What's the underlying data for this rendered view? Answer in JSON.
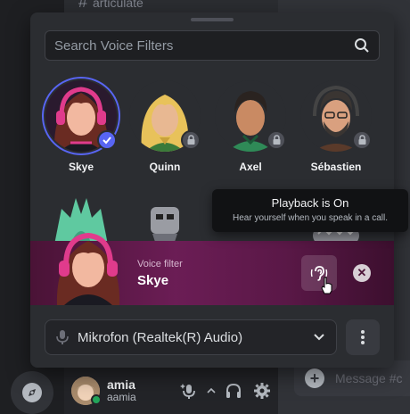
{
  "background": {
    "channel_name": "articulate",
    "message_placeholder": "Message #c"
  },
  "user_panel": {
    "username": "amia",
    "tag": "aamia"
  },
  "popup": {
    "search": {
      "placeholder": "Search Voice Filters"
    },
    "filters": [
      {
        "name": "Skye",
        "state": "selected",
        "hair": "#6a2b22",
        "skin": "#f2b8a0",
        "accent": "#e03b8c"
      },
      {
        "name": "Quinn",
        "state": "locked",
        "hair": "#e8c25a",
        "skin": "#e8b892",
        "accent": "#3a7a3a"
      },
      {
        "name": "Axel",
        "state": "locked",
        "hair": "#2a2320",
        "skin": "#c98a63",
        "accent": "#2f8a57"
      },
      {
        "name": "Sébastien",
        "state": "locked",
        "hair": "#3a3532",
        "skin": "#d9a07f",
        "accent": "#5a3a2a"
      }
    ],
    "banner": {
      "label": "Voice filter",
      "value": "Skye"
    },
    "microphone": {
      "selected": "Mikrofon (Realtek(R) Audio)"
    }
  },
  "tooltip": {
    "title": "Playback is On",
    "subtitle": "Hear yourself when you speak in a call."
  },
  "colors": {
    "accent": "#5865f2",
    "banner": "#6b1d55",
    "online": "#23a55a"
  }
}
